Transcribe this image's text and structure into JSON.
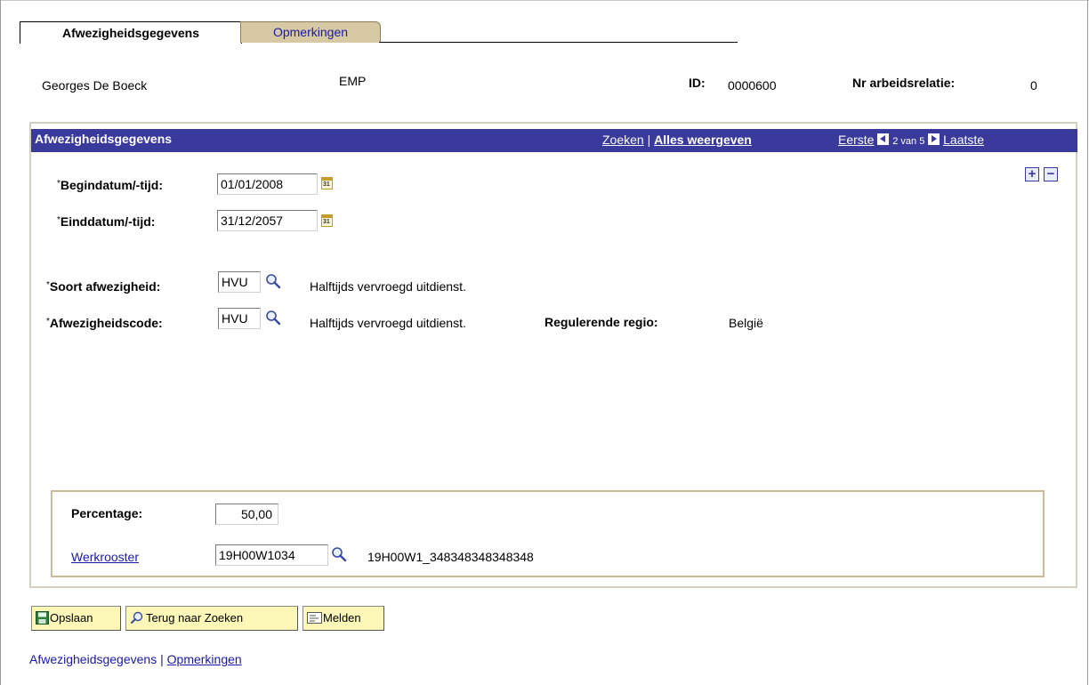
{
  "tabs": [
    {
      "label": "Afwezigheidsgegevens",
      "active": true
    },
    {
      "label": "Opmerkingen",
      "active": false
    }
  ],
  "header": {
    "employee_name": "Georges De Boeck",
    "empl_class": "EMP",
    "id_label": "ID:",
    "id_value": "0000600",
    "rel_label": "Nr arbeidsrelatie:",
    "rel_value": "0"
  },
  "scroll": {
    "title": "Afwezigheidsgegevens",
    "search_link": "Zoeken",
    "separator": "|",
    "show_all_link": "Alles weergeven",
    "first_link": "Eerste",
    "position": "2 van 5",
    "last_link": "Laatste",
    "add_row": "+",
    "delete_row": "−"
  },
  "form": {
    "begin": {
      "label": "Begindatum/-tijd:",
      "value": "01/01/2008"
    },
    "end": {
      "label": "Einddatum/-tijd:",
      "value": "31/12/2057"
    },
    "absence_type": {
      "label": "Soort afwezigheid:",
      "value": "HVU",
      "description": "Halftijds vervroegd uitdienst."
    },
    "absence_code": {
      "label": "Afwezigheidscode:",
      "value": "HVU",
      "description": "Halftijds vervroegd uitdienst."
    },
    "region": {
      "label": "Regulerende regio:",
      "value": "België"
    },
    "required_marker": "*"
  },
  "schedule": {
    "percentage_label": "Percentage:",
    "percentage_value": "50,00",
    "schedule_label": "Werkrooster",
    "schedule_value": "19H00W1034",
    "schedule_description": "19H00W1_348348348348348"
  },
  "buttons": {
    "save": "Opslaan",
    "back_to_search": "Terug naar Zoeken",
    "notify": "Melden"
  },
  "footer": {
    "link1": "Afwezigheidsgegevens",
    "separator": "|",
    "link2": "Opmerkingen"
  },
  "colors": {
    "scroll_header_bg": "#3a3a9c",
    "inactive_tab_bg": "#d7c9a3",
    "button_bg": "#fdf7b8",
    "link": "#1a1aa6"
  }
}
